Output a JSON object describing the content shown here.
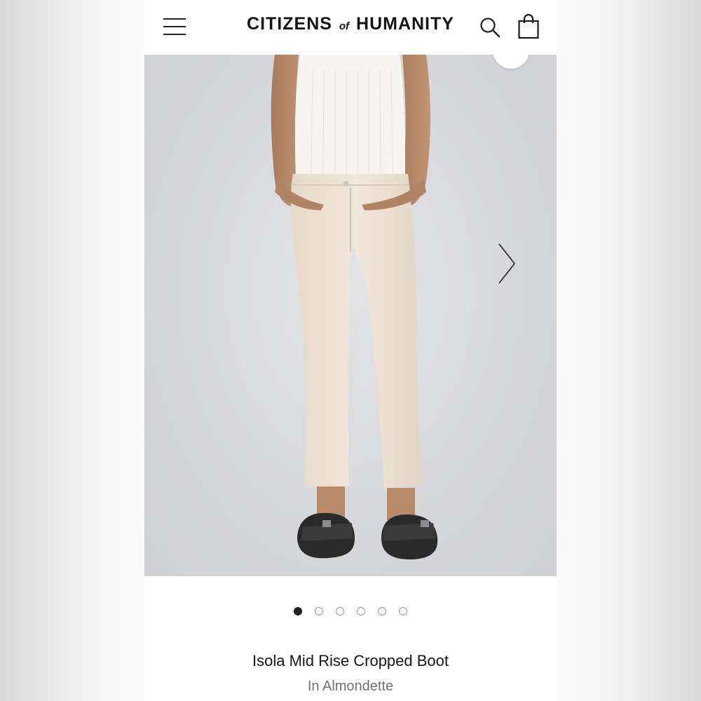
{
  "header": {
    "logo_left": "CITIZENS",
    "logo_of": "of",
    "logo_right": "HUMANITY",
    "icons": [
      "menu-icon",
      "search-icon",
      "shopping-bag-icon"
    ]
  },
  "gallery": {
    "image_alt": "Isola Mid Rise Cropped Boot in Almondette",
    "slide_count": 6,
    "active_slide": 1,
    "next_icon": "chevron-right-icon"
  },
  "product": {
    "title": "Isola Mid Rise Cropped Boot",
    "color_label": "In Almondette"
  },
  "colors": {
    "text": "#151515",
    "muted": "#707070",
    "dot_active": "#222222",
    "photo_bg": "#d6d7da",
    "jeans": "#efe3d6"
  }
}
